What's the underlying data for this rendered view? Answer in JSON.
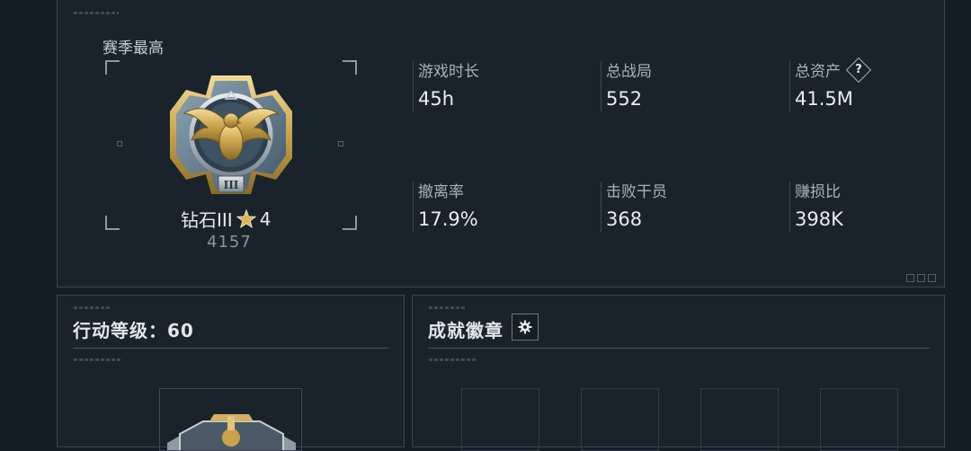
{
  "season_best": {
    "label": "赛季最高",
    "rank_name": "钻石III",
    "rank_stars": "4",
    "rank_points": "4157",
    "medal_numeral": "III"
  },
  "stats": [
    {
      "label": "游戏时长",
      "value": "45h"
    },
    {
      "label": "总战局",
      "value": "552"
    },
    {
      "label": "总资产",
      "value": "41.5M",
      "has_help": true
    },
    {
      "label": "撤离率",
      "value": "17.9%"
    },
    {
      "label": "击败干员",
      "value": "368"
    },
    {
      "label": "赚损比",
      "value": "398K"
    }
  ],
  "help_icon_glyph": "?",
  "action_level": {
    "title": "行动等级：60"
  },
  "achievements": {
    "title": "成就徽章",
    "settings_icon": "gear-icon"
  },
  "colors": {
    "background": "#151d25",
    "panel": "#1a232c",
    "border": "#3a4652",
    "medal_gold": "#c9a24a",
    "medal_steel": "#6f8798"
  }
}
